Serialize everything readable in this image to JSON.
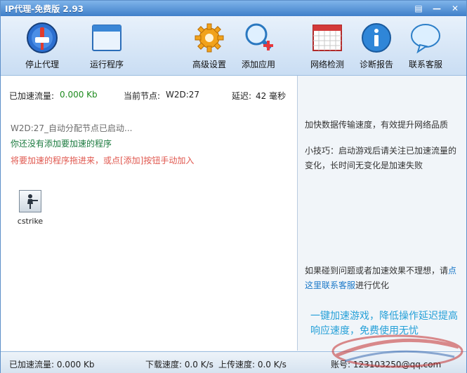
{
  "window": {
    "title": "IP代理-免费版 2.93"
  },
  "titlebar_buttons": [
    {
      "name": "menu-icon",
      "glyph": "▤"
    },
    {
      "name": "minimize-icon",
      "glyph": "—"
    },
    {
      "name": "close-icon",
      "glyph": "✕"
    }
  ],
  "toolbar": {
    "stop_proxy": "停止代理",
    "run_program": "运行程序",
    "advanced_settings": "高级设置",
    "add_app": "添加应用",
    "network_check": "网络检测",
    "diagnosis": "诊断报告",
    "contact": "联系客服"
  },
  "stats": {
    "traffic_label": "已加速流量:",
    "traffic_value": "0.000 Kb",
    "node_label": "当前节点:",
    "node_value": "W2D:27",
    "latency_label": "延迟:",
    "latency_value": "42 毫秒"
  },
  "log": {
    "line1": "W2D:27_自动分配节点已启动...",
    "line2": "你还没有添加要加速的程序",
    "line3": "将要加速的程序拖进来，或点[添加]按钮手动加入"
  },
  "apps": [
    {
      "label": "cstrike"
    }
  ],
  "side": {
    "tip1": "加快数据传输速度，有效提升网络品质",
    "tip2": "小技巧：启动游戏后请关注已加速流量的变化，长时间无变化是加速失败",
    "help_prefix": "如果碰到问题或者加速效果不理想，请",
    "help_link": "点这里联系客服",
    "help_suffix": "进行优化",
    "slogan": "一键加速游戏，降低操作延迟提高响应速度，免费使用无忧"
  },
  "status": {
    "traffic": "已加速流量: 0.000 Kb",
    "download": "下载速度: 0.0 K/s",
    "upload": "上传速度: 0.0 K/s",
    "account": "账号: 123103250@qq.com"
  },
  "colors": {
    "accent": "#3f7fc9",
    "green": "#1d8a1d",
    "warn": "#e0584f",
    "link": "#1a78c8",
    "slogan": "#25a0d8"
  }
}
